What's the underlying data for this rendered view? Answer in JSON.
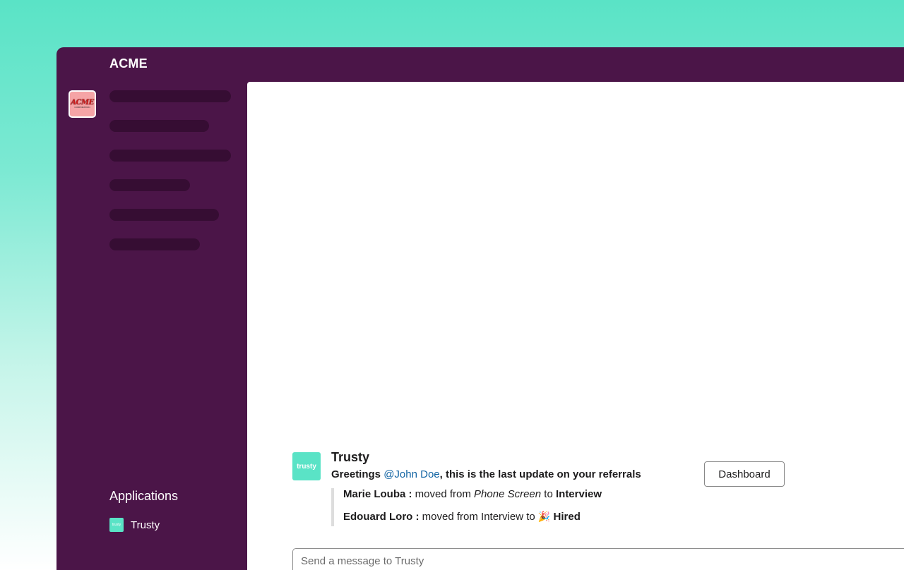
{
  "workspace": {
    "name": "ACME",
    "logo_text": "ACME",
    "logo_subtext": "CORPORATION"
  },
  "sidebar": {
    "applications_heading": "Applications",
    "apps": [
      {
        "label": "Trusty",
        "icon_text": "trusty"
      }
    ]
  },
  "message": {
    "bot_name": "Trusty",
    "avatar_text": "trusty",
    "greeting_prefix": "Greetings ",
    "mention": "@John Doe",
    "greeting_suffix": ", this is the last update on your referrals",
    "button_label": "Dashboard",
    "updates": [
      {
        "name": "Marie Louba :",
        "text_moved": " moved from ",
        "from": "Phone Screen",
        "text_to": " to ",
        "to": "Interview"
      },
      {
        "name": "Edouard Loro :",
        "text_moved": " moved from Interview to ",
        "icon": "🎉",
        "to": " Hired"
      }
    ]
  },
  "composer": {
    "placeholder": "Send a message to Trusty"
  },
  "colors": {
    "sidebar": "#4b1548",
    "skeleton": "#360d33",
    "accent": "#5ae3c6",
    "mention": "#1264a3"
  }
}
